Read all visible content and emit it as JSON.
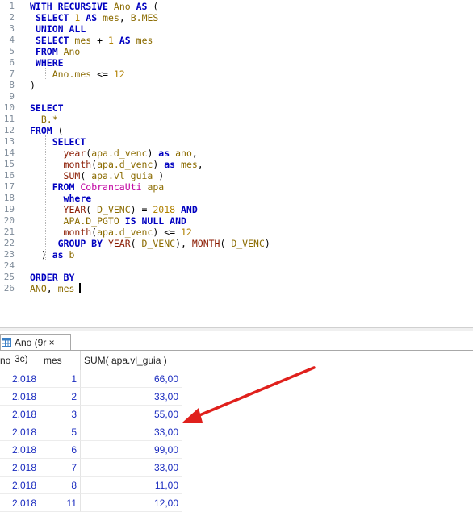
{
  "editor": {
    "lines": [
      {
        "n": "1",
        "tokens": [
          [
            "kw",
            "WITH"
          ],
          [
            "t",
            " "
          ],
          [
            "kw",
            "RECURSIVE"
          ],
          [
            "t",
            " "
          ],
          [
            "id",
            "Ano"
          ],
          [
            "t",
            " "
          ],
          [
            "kw",
            "AS"
          ],
          [
            "t",
            " ("
          ]
        ]
      },
      {
        "n": "2",
        "tokens": [
          [
            "t",
            " "
          ],
          [
            "kw",
            "SELECT"
          ],
          [
            "t",
            " "
          ],
          [
            "num",
            "1"
          ],
          [
            "t",
            " "
          ],
          [
            "kw",
            "AS"
          ],
          [
            "t",
            " "
          ],
          [
            "id",
            "mes"
          ],
          [
            "t",
            ", "
          ],
          [
            "id",
            "B.MES"
          ]
        ]
      },
      {
        "n": "3",
        "tokens": [
          [
            "t",
            " "
          ],
          [
            "kw",
            "UNION ALL"
          ]
        ]
      },
      {
        "n": "4",
        "tokens": [
          [
            "t",
            " "
          ],
          [
            "kw",
            "SELECT"
          ],
          [
            "t",
            " "
          ],
          [
            "id",
            "mes"
          ],
          [
            "t",
            " + "
          ],
          [
            "num",
            "1"
          ],
          [
            "t",
            " "
          ],
          [
            "kw",
            "AS"
          ],
          [
            "t",
            " "
          ],
          [
            "id",
            "mes"
          ]
        ]
      },
      {
        "n": "5",
        "tokens": [
          [
            "t",
            " "
          ],
          [
            "kw",
            "FROM"
          ],
          [
            "t",
            " "
          ],
          [
            "id",
            "Ano"
          ]
        ]
      },
      {
        "n": "6",
        "tokens": [
          [
            "t",
            " "
          ],
          [
            "kw",
            "WHERE"
          ]
        ]
      },
      {
        "n": "7",
        "tokens": [
          [
            "t",
            "    "
          ],
          [
            "id",
            "Ano.mes"
          ],
          [
            "t",
            " <= "
          ],
          [
            "num",
            "12"
          ]
        ]
      },
      {
        "n": "8",
        "tokens": [
          [
            "t",
            ")"
          ]
        ]
      },
      {
        "n": "9",
        "tokens": []
      },
      {
        "n": "10",
        "tokens": [
          [
            "kw",
            "SELECT"
          ]
        ]
      },
      {
        "n": "11",
        "tokens": [
          [
            "t",
            "  "
          ],
          [
            "id",
            "B.*"
          ]
        ]
      },
      {
        "n": "12",
        "tokens": [
          [
            "kw",
            "FROM"
          ],
          [
            "t",
            " ("
          ]
        ]
      },
      {
        "n": "13",
        "tokens": [
          [
            "t",
            "    "
          ],
          [
            "kw",
            "SELECT"
          ]
        ]
      },
      {
        "n": "14",
        "tokens": [
          [
            "t",
            "      "
          ],
          [
            "fn",
            "year"
          ],
          [
            "t",
            "("
          ],
          [
            "id",
            "apa.d_venc"
          ],
          [
            "t",
            ") "
          ],
          [
            "kw",
            "as"
          ],
          [
            "t",
            " "
          ],
          [
            "id",
            "ano"
          ],
          [
            "t",
            ","
          ]
        ]
      },
      {
        "n": "15",
        "tokens": [
          [
            "t",
            "      "
          ],
          [
            "fn",
            "month"
          ],
          [
            "t",
            "("
          ],
          [
            "id",
            "apa.d_venc"
          ],
          [
            "t",
            ") "
          ],
          [
            "kw",
            "as"
          ],
          [
            "t",
            " "
          ],
          [
            "id",
            "mes"
          ],
          [
            "t",
            ","
          ]
        ]
      },
      {
        "n": "16",
        "tokens": [
          [
            "t",
            "      "
          ],
          [
            "fn",
            "SUM"
          ],
          [
            "t",
            "( "
          ],
          [
            "id",
            "apa.vl_guia"
          ],
          [
            "t",
            " )"
          ]
        ]
      },
      {
        "n": "17",
        "tokens": [
          [
            "t",
            "    "
          ],
          [
            "kw",
            "FROM"
          ],
          [
            "t",
            " "
          ],
          [
            "tb",
            "CobrancaUti"
          ],
          [
            "t",
            " "
          ],
          [
            "id",
            "apa"
          ]
        ]
      },
      {
        "n": "18",
        "tokens": [
          [
            "t",
            "      "
          ],
          [
            "kw",
            "where"
          ]
        ]
      },
      {
        "n": "19",
        "tokens": [
          [
            "t",
            "      "
          ],
          [
            "fn",
            "YEAR"
          ],
          [
            "t",
            "( "
          ],
          [
            "id",
            "D_VENC"
          ],
          [
            "t",
            ") = "
          ],
          [
            "num",
            "2018"
          ],
          [
            "t",
            " "
          ],
          [
            "kw",
            "AND"
          ]
        ]
      },
      {
        "n": "20",
        "tokens": [
          [
            "t",
            "      "
          ],
          [
            "id",
            "APA.D_PGTO"
          ],
          [
            "t",
            " "
          ],
          [
            "kw",
            "IS NULL"
          ],
          [
            "t",
            " "
          ],
          [
            "kw",
            "AND"
          ]
        ]
      },
      {
        "n": "21",
        "tokens": [
          [
            "t",
            "      "
          ],
          [
            "fn",
            "month"
          ],
          [
            "t",
            "("
          ],
          [
            "id",
            "apa.d_venc"
          ],
          [
            "t",
            ") <= "
          ],
          [
            "num",
            "12"
          ]
        ]
      },
      {
        "n": "22",
        "tokens": [
          [
            "t",
            "     "
          ],
          [
            "kw",
            "GROUP BY"
          ],
          [
            "t",
            " "
          ],
          [
            "fn",
            "YEAR"
          ],
          [
            "t",
            "( "
          ],
          [
            "id",
            "D_VENC"
          ],
          [
            "t",
            "), "
          ],
          [
            "fn",
            "MONTH"
          ],
          [
            "t",
            "( "
          ],
          [
            "id",
            "D_VENC"
          ],
          [
            "t",
            ")"
          ]
        ]
      },
      {
        "n": "23",
        "tokens": [
          [
            "t",
            "  ) "
          ],
          [
            "kw",
            "as"
          ],
          [
            "t",
            " "
          ],
          [
            "id",
            "b"
          ]
        ]
      },
      {
        "n": "24",
        "tokens": []
      },
      {
        "n": "25",
        "tokens": [
          [
            "kw",
            "ORDER BY"
          ]
        ]
      },
      {
        "n": "26",
        "tokens": [
          [
            "id",
            "ANO"
          ],
          [
            "t",
            ", "
          ],
          [
            "id",
            "mes"
          ],
          [
            "t",
            " "
          ]
        ]
      }
    ]
  },
  "results": {
    "tab_label": "Ano (9r × 3c)",
    "columns": [
      "no",
      "mes",
      "SUM( apa.vl_guia )"
    ],
    "rows": [
      [
        "2.018",
        "1",
        "66,00"
      ],
      [
        "2.018",
        "2",
        "33,00"
      ],
      [
        "2.018",
        "3",
        "55,00"
      ],
      [
        "2.018",
        "5",
        "33,00"
      ],
      [
        "2.018",
        "6",
        "99,00"
      ],
      [
        "2.018",
        "7",
        "33,00"
      ],
      [
        "2.018",
        "8",
        "11,00"
      ],
      [
        "2.018",
        "11",
        "12,00"
      ]
    ]
  },
  "colors": {
    "keyword": "#0000c0",
    "identifier": "#8b6b00",
    "function": "#8a1a00",
    "table": "#c000a0",
    "grid_value": "#1a2bbf",
    "annotation_arrow": "#e0201c"
  },
  "icons": {
    "tab_icon": "grid-table-icon",
    "arrow": "red-arrow-annotation"
  }
}
